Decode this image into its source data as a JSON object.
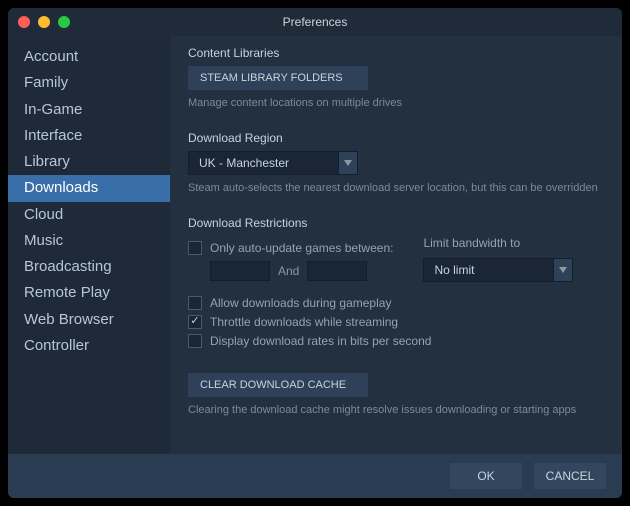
{
  "window": {
    "title": "Preferences"
  },
  "sidebar": {
    "items": [
      {
        "label": "Account"
      },
      {
        "label": "Family"
      },
      {
        "label": "In-Game"
      },
      {
        "label": "Interface"
      },
      {
        "label": "Library"
      },
      {
        "label": "Downloads",
        "active": true
      },
      {
        "label": "Cloud"
      },
      {
        "label": "Music"
      },
      {
        "label": "Broadcasting"
      },
      {
        "label": "Remote Play"
      },
      {
        "label": "Web Browser"
      },
      {
        "label": "Controller"
      }
    ]
  },
  "content": {
    "libraries": {
      "heading": "Content Libraries",
      "button": "STEAM LIBRARY FOLDERS",
      "hint": "Manage content locations on multiple drives"
    },
    "region": {
      "heading": "Download Region",
      "value": "UK - Manchester",
      "hint": "Steam auto-selects the nearest download server location, but this can be overridden"
    },
    "restrictions": {
      "heading": "Download Restrictions",
      "auto_update_label": "Only auto-update games between:",
      "and_label": "And",
      "bandwidth_heading": "Limit bandwidth to",
      "bandwidth_value": "No limit",
      "allow_gameplay": "Allow downloads during gameplay",
      "throttle_streaming": "Throttle downloads while streaming",
      "bits_per_second": "Display download rates in bits per second"
    },
    "cache": {
      "button": "CLEAR DOWNLOAD CACHE",
      "hint": "Clearing the download cache might resolve issues downloading or starting apps"
    }
  },
  "footer": {
    "ok": "OK",
    "cancel": "CANCEL"
  }
}
